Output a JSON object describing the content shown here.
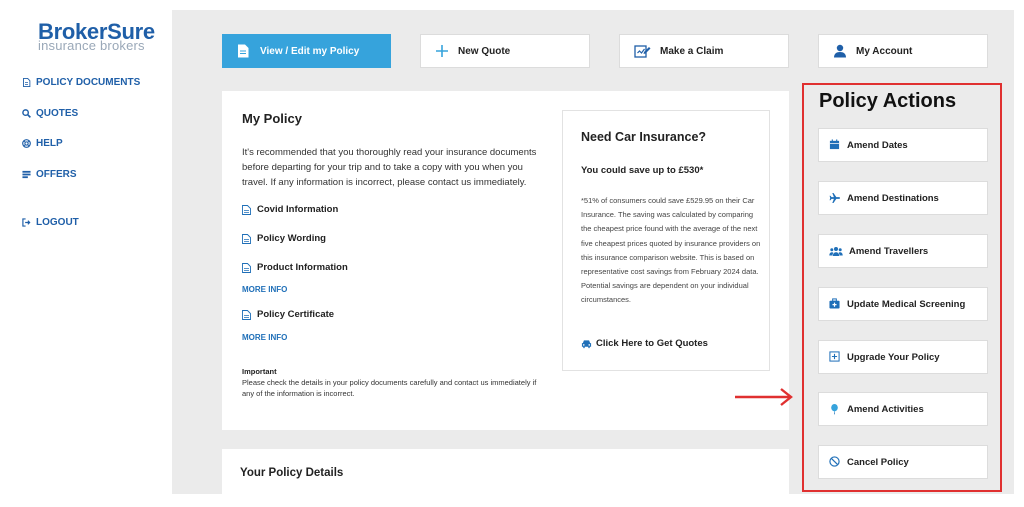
{
  "brand": {
    "name": "BrokerSure",
    "tagline": "insurance brokers",
    "primary_color": "#1f5fa8",
    "accent_color": "#36a3dc"
  },
  "sidebar": {
    "items": [
      {
        "label": "POLICY DOCUMENTS",
        "icon": "document-icon"
      },
      {
        "label": "QUOTES",
        "icon": "search-icon"
      },
      {
        "label": "HELP",
        "icon": "lifebuoy-icon"
      },
      {
        "label": "OFFERS",
        "icon": "offers-icon"
      },
      {
        "label": "LOGOUT",
        "icon": "logout-icon"
      }
    ]
  },
  "tabs": [
    {
      "label": "View / Edit my Policy",
      "icon": "document-icon",
      "active": true
    },
    {
      "label": "New Quote",
      "icon": "plus-icon",
      "active": false
    },
    {
      "label": "Make a Claim",
      "icon": "claim-icon",
      "active": false
    },
    {
      "label": "My Account",
      "icon": "user-icon",
      "active": false
    }
  ],
  "my_policy": {
    "title": "My Policy",
    "intro": "It's recommended that you thoroughly read your insurance documents before departing for your trip and to take a copy with you when you travel. If any information is incorrect, please contact us immediately.",
    "documents": [
      {
        "label": "Covid Information"
      },
      {
        "label": "Policy Wording"
      },
      {
        "label": "Product Information",
        "more": "MORE INFO"
      },
      {
        "label": "Policy Certificate",
        "more": "MORE INFO"
      }
    ],
    "important_title": "Important",
    "important_text": "Please check the details in your policy documents carefully and contact us immediately if any of the information is incorrect."
  },
  "car_insurance": {
    "title": "Need Car Insurance?",
    "subtitle": "You could save up to £530*",
    "disclaimer": "*51% of consumers could save £529.95 on their Car Insurance. The saving was calculated by comparing the cheapest price found with the average of the next five cheapest prices quoted by insurance providers on this insurance comparison website. This is based on representative cost savings from February 2024 data. Potential savings are dependent on your individual circumstances.",
    "cta": "Click Here to Get Quotes"
  },
  "policy_details": {
    "title": "Your Policy Details"
  },
  "policy_actions": {
    "title": "Policy Actions",
    "highlight_color": "#e03030",
    "items": [
      {
        "label": "Amend Dates",
        "icon": "calendar-icon"
      },
      {
        "label": "Amend Destinations",
        "icon": "plane-icon"
      },
      {
        "label": "Amend Travellers",
        "icon": "people-icon"
      },
      {
        "label": "Update Medical Screening",
        "icon": "medical-icon"
      },
      {
        "label": "Upgrade Your Policy",
        "icon": "upgrade-icon"
      },
      {
        "label": "Amend Activities",
        "icon": "balloon-icon"
      },
      {
        "label": "Cancel Policy",
        "icon": "cancel-icon"
      }
    ]
  }
}
